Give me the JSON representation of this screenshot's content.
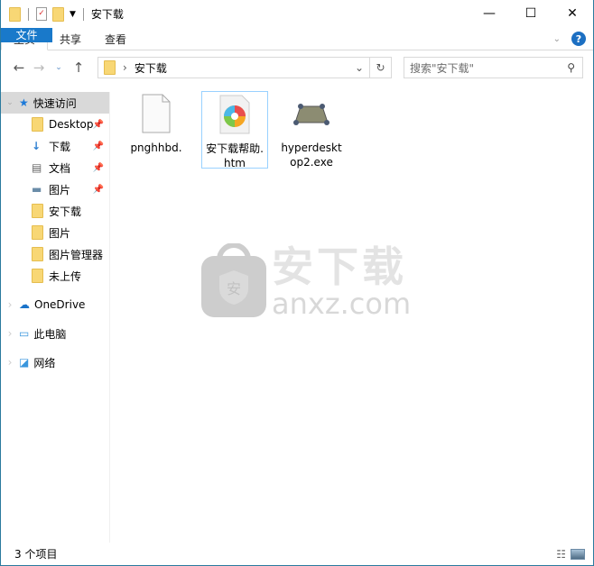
{
  "window": {
    "title": "安下载",
    "controls": {
      "minimize": "—",
      "maximize": "☐",
      "close": "✕"
    }
  },
  "ribbon": {
    "tabs": [
      {
        "label": "文件"
      },
      {
        "label": "主页"
      },
      {
        "label": "共享"
      },
      {
        "label": "查看"
      }
    ],
    "help": "?"
  },
  "nav": {
    "path": "安下载",
    "search_placeholder": "搜索\"安下载\""
  },
  "sidebar": {
    "quick_access": "快速访问",
    "items": [
      {
        "label": "Desktop",
        "pinned": true
      },
      {
        "label": "下载",
        "pinned": true
      },
      {
        "label": "文档",
        "pinned": true
      },
      {
        "label": "图片",
        "pinned": true
      },
      {
        "label": "安下载",
        "pinned": false
      },
      {
        "label": "图片",
        "pinned": false
      },
      {
        "label": "图片管理器",
        "pinned": false
      },
      {
        "label": "未上传",
        "pinned": false
      }
    ],
    "onedrive": "OneDrive",
    "thispc": "此电脑",
    "network": "网络"
  },
  "files": [
    {
      "name": "pnghhbd."
    },
    {
      "name": "安下载帮助.htm"
    },
    {
      "name": "hyperdesktop2.exe"
    }
  ],
  "watermark": {
    "cn": "安下载",
    "en": "anxz.com"
  },
  "status": {
    "count": "3 个项目"
  }
}
